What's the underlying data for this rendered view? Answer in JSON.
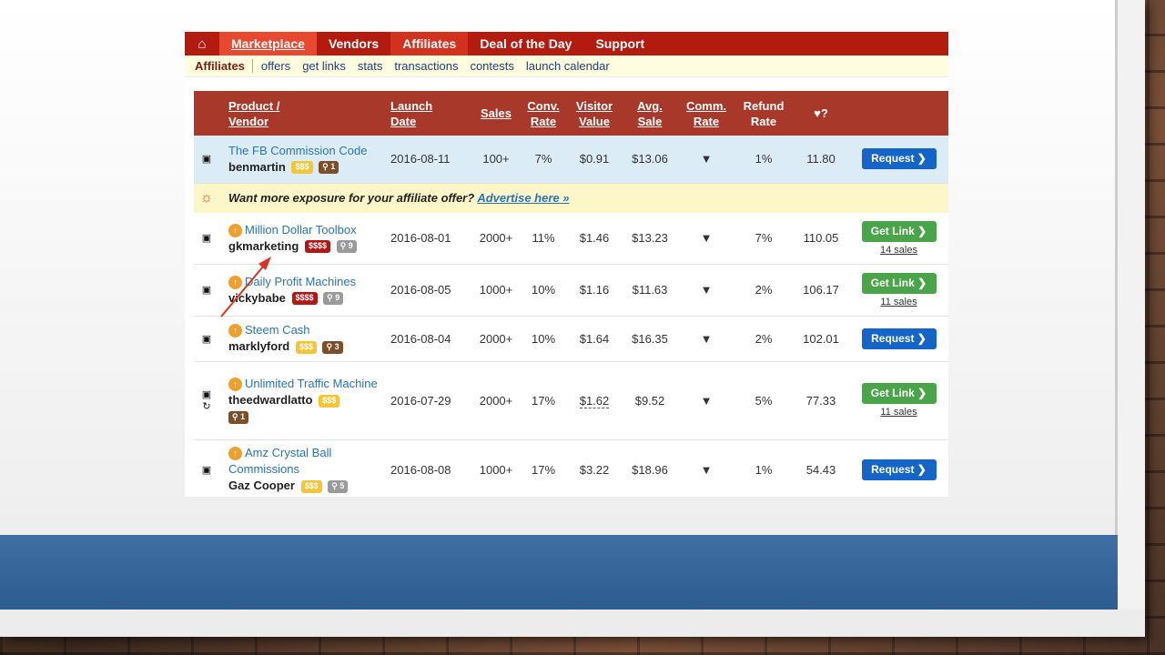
{
  "nav": {
    "home_icon": "home-icon",
    "items": [
      {
        "label": "Marketplace"
      },
      {
        "label": "Vendors"
      },
      {
        "label": "Affiliates"
      },
      {
        "label": "Deal of the Day"
      },
      {
        "label": "Support"
      }
    ]
  },
  "subnav": {
    "current": "Affiliates",
    "links": [
      "offers",
      "get links",
      "stats",
      "transactions",
      "contests",
      "launch calendar"
    ]
  },
  "table": {
    "headers": {
      "product_l1": "Product /",
      "product_l2": "Vendor",
      "launch_l1": "Launch",
      "launch_l2": "Date",
      "sales": "Sales",
      "conv_l1": "Conv.",
      "conv_l2": "Rate",
      "visitor_l1": "Visitor",
      "visitor_l2": "Value",
      "avg_l1": "Avg.",
      "avg_l2": "Sale",
      "comm_l1": "Comm.",
      "comm_l2": "Rate",
      "refund_l1": "Refund",
      "refund_l2": "Rate",
      "grav": "♥?"
    },
    "ad": {
      "text": "Want more exposure for your affiliate offer?",
      "link": "Advertise here »"
    },
    "rows": [
      {
        "product": "The FB Commission Code",
        "vendor": "benmartin",
        "price_badge": "$$$",
        "trophy": "1",
        "date": "2016-08-11",
        "sales": "100+",
        "conv": "7%",
        "visitor": "$0.91",
        "avg": "$13.06",
        "refund": "1%",
        "grav": "11.80",
        "action": "Request ❯",
        "sales_count": ""
      },
      {
        "product": "Million Dollar Toolbox",
        "vendor": "gkmarketing",
        "price_badge": "$$$$",
        "trophy": "9",
        "date": "2016-08-01",
        "sales": "2000+",
        "conv": "11%",
        "visitor": "$1.46",
        "avg": "$13.23",
        "refund": "7%",
        "grav": "110.05",
        "action": "Get Link ❯",
        "sales_count": "14 sales"
      },
      {
        "product": "Daily Profit Machines",
        "vendor": "vickybabe",
        "price_badge": "$$$$",
        "trophy": "9",
        "date": "2016-08-05",
        "sales": "1000+",
        "conv": "10%",
        "visitor": "$1.16",
        "avg": "$11.63",
        "refund": "2%",
        "grav": "106.17",
        "action": "Get Link ❯",
        "sales_count": "11 sales"
      },
      {
        "product": "Steem Cash",
        "vendor": "marklyford",
        "price_badge": "$$$",
        "trophy": "3",
        "date": "2016-08-04",
        "sales": "2000+",
        "conv": "10%",
        "visitor": "$1.64",
        "avg": "$16.35",
        "refund": "2%",
        "grav": "102.01",
        "action": "Request ❯",
        "sales_count": ""
      },
      {
        "product": "Unlimited Traffic Machine",
        "vendor": "theedwardlatto",
        "price_badge": "$$$",
        "trophy": "1",
        "date": "2016-07-29",
        "sales": "2000+",
        "conv": "17%",
        "visitor": "$1.62",
        "avg": "$9.52",
        "refund": "5%",
        "grav": "77.33",
        "action": "Get Link ❯",
        "sales_count": "11 sales"
      },
      {
        "product": "Amz Crystal Ball Commissions",
        "vendor": "Gaz Cooper",
        "price_badge": "$$$",
        "trophy": "5",
        "date": "2016-08-08",
        "sales": "1000+",
        "conv": "17%",
        "visitor": "$3.22",
        "avg": "$18.96",
        "refund": "1%",
        "grav": "54.43",
        "action": "Request ❯",
        "sales_count": ""
      }
    ]
  },
  "colors": {
    "nav_bg": "#b31b0e",
    "header_bg": "#a8382a",
    "request_btn": "#1565c9",
    "getlink_btn": "#4aa54a",
    "slide_band": "#2d5c8f"
  }
}
